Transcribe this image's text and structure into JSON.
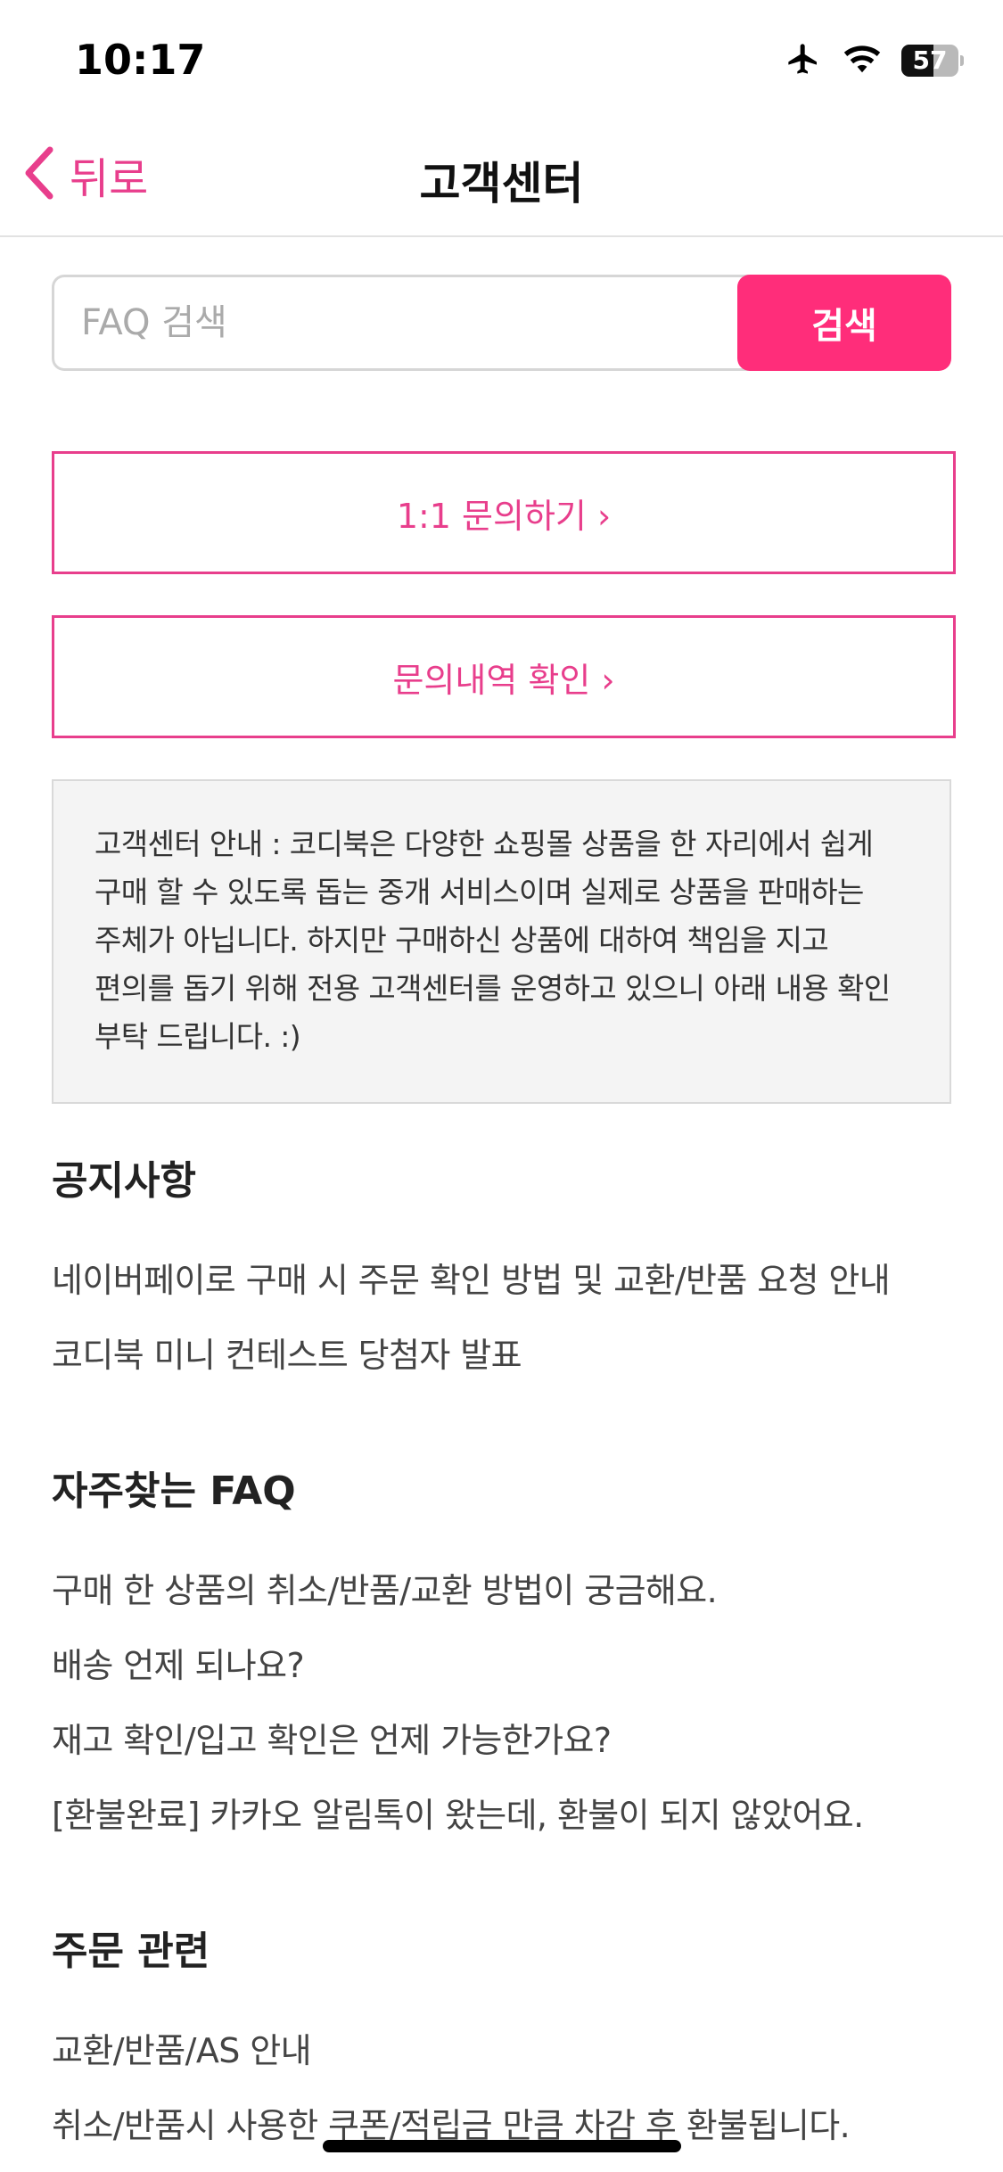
{
  "status_bar": {
    "time": "10:17",
    "battery": "57",
    "battery_level": 0.57,
    "icons": [
      "airplane-icon",
      "wifi-icon",
      "battery-icon"
    ]
  },
  "nav": {
    "back_label": "뒤로",
    "title": "고객센터"
  },
  "search": {
    "placeholder": "FAQ 검색",
    "value": "",
    "button_label": "검색"
  },
  "buttons": {
    "inquiry": "1:1 문의하기 ›",
    "history": "문의내역 확인 ›"
  },
  "info": {
    "text": "고객센터 안내 : 코디북은 다양한 쇼핑몰 상품을 한 자리에서 쉽게 구매 할 수 있도록 돕는 중개 서비스이며 실제로 상품을 판매하는 주체가 아닙니다. 하지만 구매하신 상품에 대하여 책임을 지고 편의를 돕기 위해 전용 고객센터를 운영하고 있으니 아래 내용 확인 부탁 드립니다. :)"
  },
  "sections": [
    {
      "title": "공지사항",
      "items": [
        "네이버페이로 구매 시 주문 확인 방법 및 교환/반품 요청 안내",
        "코디북 미니 컨테스트 당첨자 발표"
      ]
    },
    {
      "title": "자주찾는 FAQ",
      "items": [
        "구매 한 상품의 취소/반품/교환 방법이 궁금해요.",
        "배송 언제 되나요?",
        "재고 확인/입고 확인은 언제 가능한가요?",
        "[환불완료] 카카오 알림톡이 왔는데, 환불이 되지 않았어요."
      ]
    },
    {
      "title": "주문 관련",
      "items": [
        "교환/반품/AS 안내",
        "취소/반품시 사용한 쿠폰/적립금 만큼 차감 후 환불됩니다."
      ]
    }
  ],
  "colors": {
    "accent": "#e83e8c",
    "search_button": "#ff2d7a",
    "info_bg": "#f4f4f4"
  }
}
